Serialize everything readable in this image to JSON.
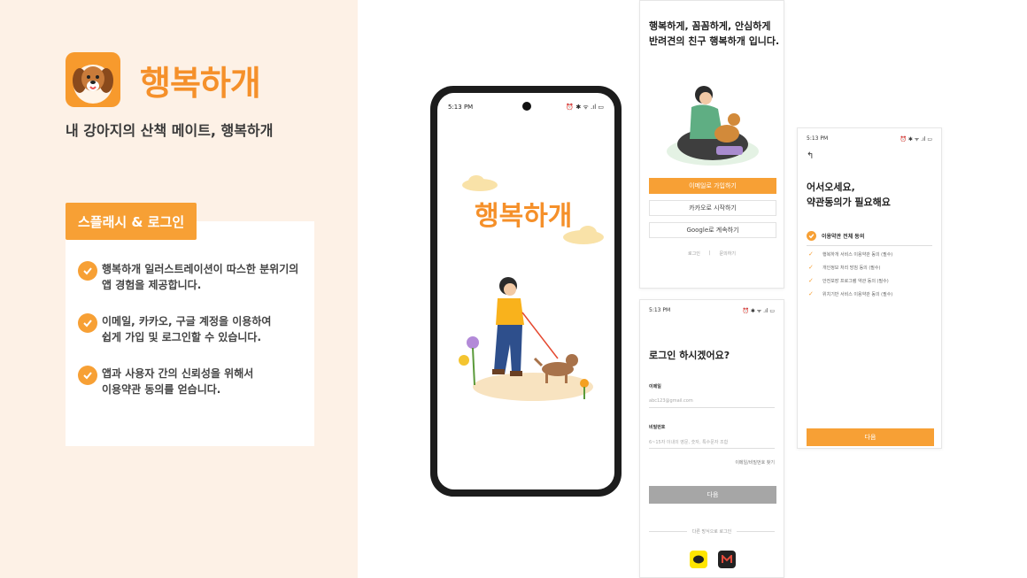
{
  "brand": {
    "name": "행복하개",
    "tagline": "내 강아지의 산책 메이트, 행복하개"
  },
  "feature_section": {
    "tab_label": "스플래시 & 로그인",
    "items": [
      {
        "line1": "행복하개 일러스트레이션이 따스한 분위기의",
        "line2": "앱 경험을 제공합니다."
      },
      {
        "line1": "이메일, 카카오, 구글 계정을 이용하여",
        "line2": "쉽게 가입 및 로그인할 수 있습니다."
      },
      {
        "line1": "앱과 사용자 간의 신뢰성을 위해서",
        "line2": "이용약관 동의를 얻습니다."
      }
    ]
  },
  "splash_phone": {
    "time": "5:13 PM",
    "status_icons": "⏰ ✱ ᯤ .ıl ▭",
    "brand": "행복하개"
  },
  "onboarding_screen": {
    "headline_1": "행복하게, 꼼꼼하게, 안심하게",
    "headline_2": "반려견의 친구 행복하개 입니다.",
    "email_signup": "이메일로 가입하기",
    "kakao_start": "카카오로 시작하기",
    "google_continue": "Google로 계속하기",
    "login_link": "로그인",
    "inquiry_link": "문의하기"
  },
  "login_screen": {
    "time": "5:13 PM",
    "status_icons": "⏰ ✱ ᯤ .ıl ▭",
    "title": "로그인 하시겠어요?",
    "email_label": "이메일",
    "email_placeholder": "abc123@gmail.com",
    "password_label": "비밀번호",
    "password_placeholder": "6~15자 이내의 영문, 숫자, 특수문자 조합",
    "find_link": "이메일/비밀번호 찾기",
    "next_button": "다음",
    "other_login": "다른 방식으로 로그인"
  },
  "terms_screen": {
    "time": "5:13 PM",
    "status_icons": "⏰ ✱ ᯤ .ıl ▭",
    "back": "↰",
    "title_1": "어서오세요,",
    "title_2": "약관동의가 필요해요",
    "agree_all": "이용약관 전체 동의",
    "terms": [
      "행복하개 서비스 이용약관 동의 (필수)",
      "개인정보 처리 방침 동의 (필수)",
      "안전보장 프로그램 약관 동의 (필수)",
      "위치기반 서비스 이용약관 동의 (필수)"
    ],
    "next_button": "다음"
  },
  "colors": {
    "accent": "#f7a035",
    "brand_text": "#f5902a",
    "panel_bg": "#fdf1e6"
  }
}
